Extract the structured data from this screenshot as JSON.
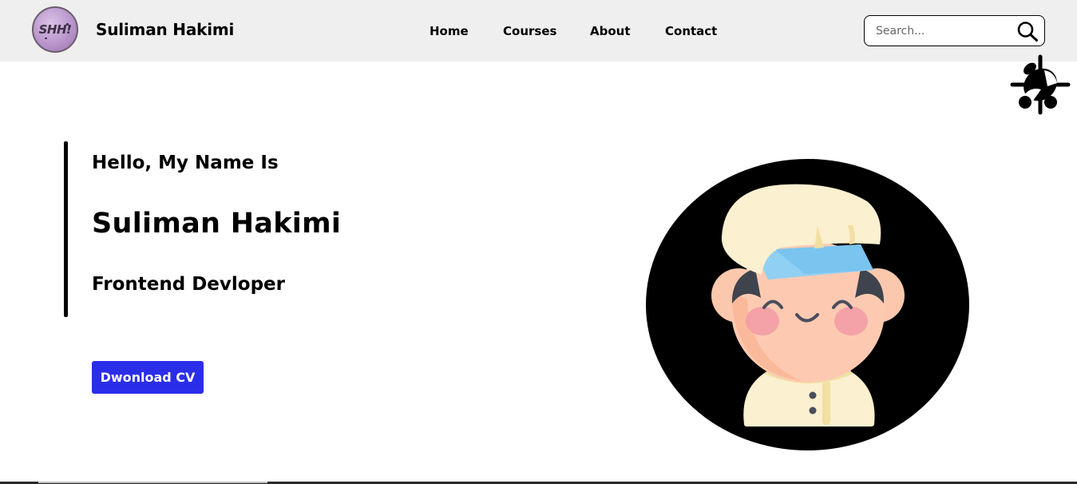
{
  "header": {
    "logo_text": "SHH!",
    "brand_name": "Suliman Hakimi",
    "nav": [
      {
        "label": "Home"
      },
      {
        "label": "Courses"
      },
      {
        "label": "About"
      },
      {
        "label": "Contact"
      }
    ],
    "search": {
      "placeholder": "Search...",
      "value": "",
      "icon": "search-icon"
    },
    "floating_icon": "bug-icon"
  },
  "hero": {
    "greeting": "Hello, My Name Is",
    "name": "Suliman Hakimi",
    "role": "Frontend Devloper",
    "cta_label": "Dwonload CV",
    "avatar_icon": "avatar-illustration"
  },
  "colors": {
    "nav_background": "#efefef",
    "accent_button": "#2b2ee8",
    "avatar_circle": "#000000",
    "text": "#000000"
  }
}
